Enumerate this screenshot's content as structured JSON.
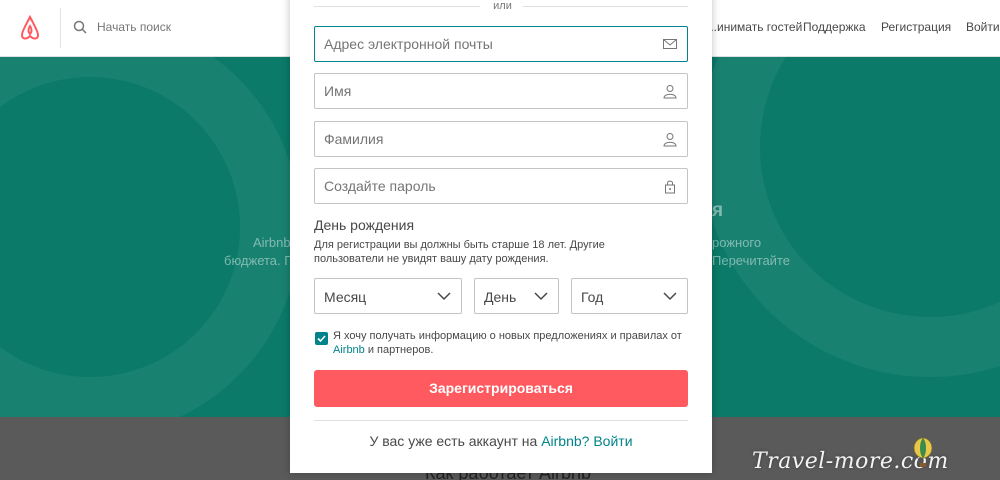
{
  "header": {
    "search_placeholder": "Начать поиск",
    "nav": [
      "...инимать гостей",
      "Поддержка",
      "Регистрация",
      "Войти"
    ]
  },
  "hero": {
    "heading_fragment": "я",
    "line1_left": "Airbnb",
    "line1_right": "рожного",
    "line2_left": "бюджета. Г",
    "line2_right": "Перечитайте"
  },
  "lower": {
    "heading": "Как работает Airbnb"
  },
  "modal": {
    "or": "или",
    "email_placeholder": "Адрес электронной почты",
    "first_name_placeholder": "Имя",
    "last_name_placeholder": "Фамилия",
    "password_placeholder": "Создайте пароль",
    "birthday_label": "День рождения",
    "birthday_hint": "Для регистрации вы должны быть старше 18 лет. Другие пользователи не увидят вашу дату рождения.",
    "month": "Месяц",
    "day": "День",
    "year": "Год",
    "consent_text": "Я хочу получать информацию о новых предложениях и правилах от",
    "consent_brand": "Airbnb",
    "consent_tail": "и партнеров.",
    "signup_button": "Зарегистрироваться",
    "have_account_text": "У вас уже есть аккаунт на",
    "have_account_brand": "Airbnb?",
    "login_link": "Войти"
  },
  "watermark": "Travel-more.com",
  "colors": {
    "brand_teal": "#008489",
    "signup_red": "#ff5a5f",
    "hero_green": "#0b7a68"
  }
}
